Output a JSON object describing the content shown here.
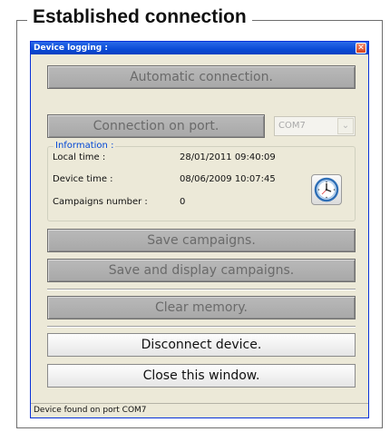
{
  "group_title": "Established connection",
  "window": {
    "title": "Device logging :",
    "close_glyph": "✕"
  },
  "buttons": {
    "automatic": "Automatic connection.",
    "connection_on_port": "Connection on port.",
    "save_campaigns": "Save campaigns.",
    "save_display": "Save and display campaigns.",
    "clear_memory": "Clear memory.",
    "disconnect": "Disconnect device.",
    "close_window": "Close this window."
  },
  "port_select": {
    "value": "COM7"
  },
  "information": {
    "legend": "Information :",
    "local_time_label": "Local time :",
    "local_time_value": "28/01/2011 09:40:09",
    "device_time_label": "Device time :",
    "device_time_value": "08/06/2009 10:07:45",
    "campaigns_label": "Campaigns number :",
    "campaigns_value": "0",
    "clock_icon": "clock-icon"
  },
  "status": "Device found on port COM7",
  "colors": {
    "titlebar": "#0a4ad6",
    "window_bg": "#ece9d8",
    "legend_text": "#0046d5"
  }
}
